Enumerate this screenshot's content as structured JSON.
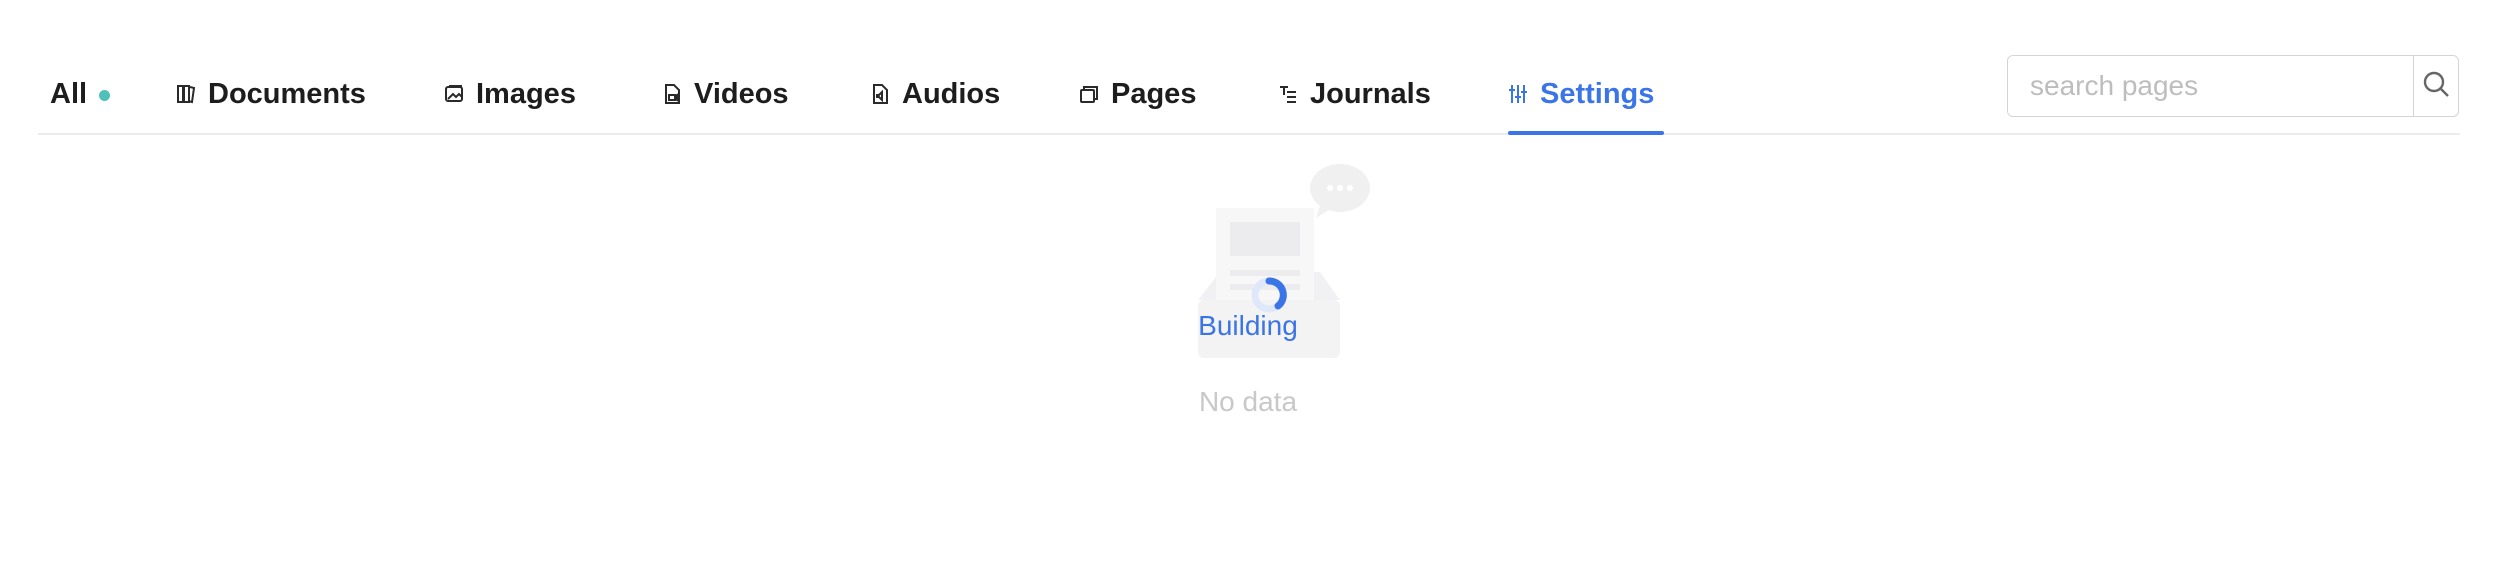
{
  "tabs": [
    {
      "label": "All",
      "icon": "status-dot",
      "active": false
    },
    {
      "label": "Documents",
      "icon": "books-icon",
      "active": false
    },
    {
      "label": "Images",
      "icon": "image-icon",
      "active": false
    },
    {
      "label": "Videos",
      "icon": "video-file-icon",
      "active": false
    },
    {
      "label": "Audios",
      "icon": "audio-file-icon",
      "active": false
    },
    {
      "label": "Pages",
      "icon": "pages-icon",
      "active": false
    },
    {
      "label": "Journals",
      "icon": "journal-icon",
      "active": false
    },
    {
      "label": "Settings",
      "icon": "sliders-icon",
      "active": true
    }
  ],
  "search": {
    "placeholder": "search pages",
    "value": ""
  },
  "content": {
    "loading_text": "Building",
    "empty_text": "No data"
  },
  "colors": {
    "accent": "#3b74e6",
    "status_dot": "#4fc1b8",
    "text": "#1d1d1d",
    "muted": "#c8c8c8"
  }
}
